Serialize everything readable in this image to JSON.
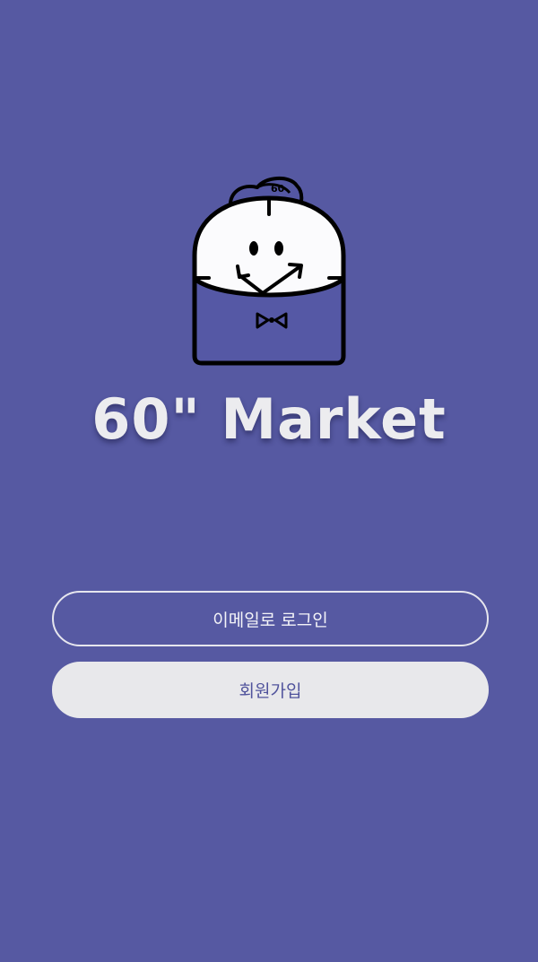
{
  "app": {
    "title": "60\" Market",
    "logo_icon": "clock-mascot-logo-icon"
  },
  "actions": {
    "email_login_label": "이메일로 로그인",
    "signup_label": "회원가입"
  },
  "colors": {
    "background": "#5659a2",
    "text_light": "#ececef",
    "signup_fill": "#e8e8eb",
    "signup_text": "#50539c"
  }
}
